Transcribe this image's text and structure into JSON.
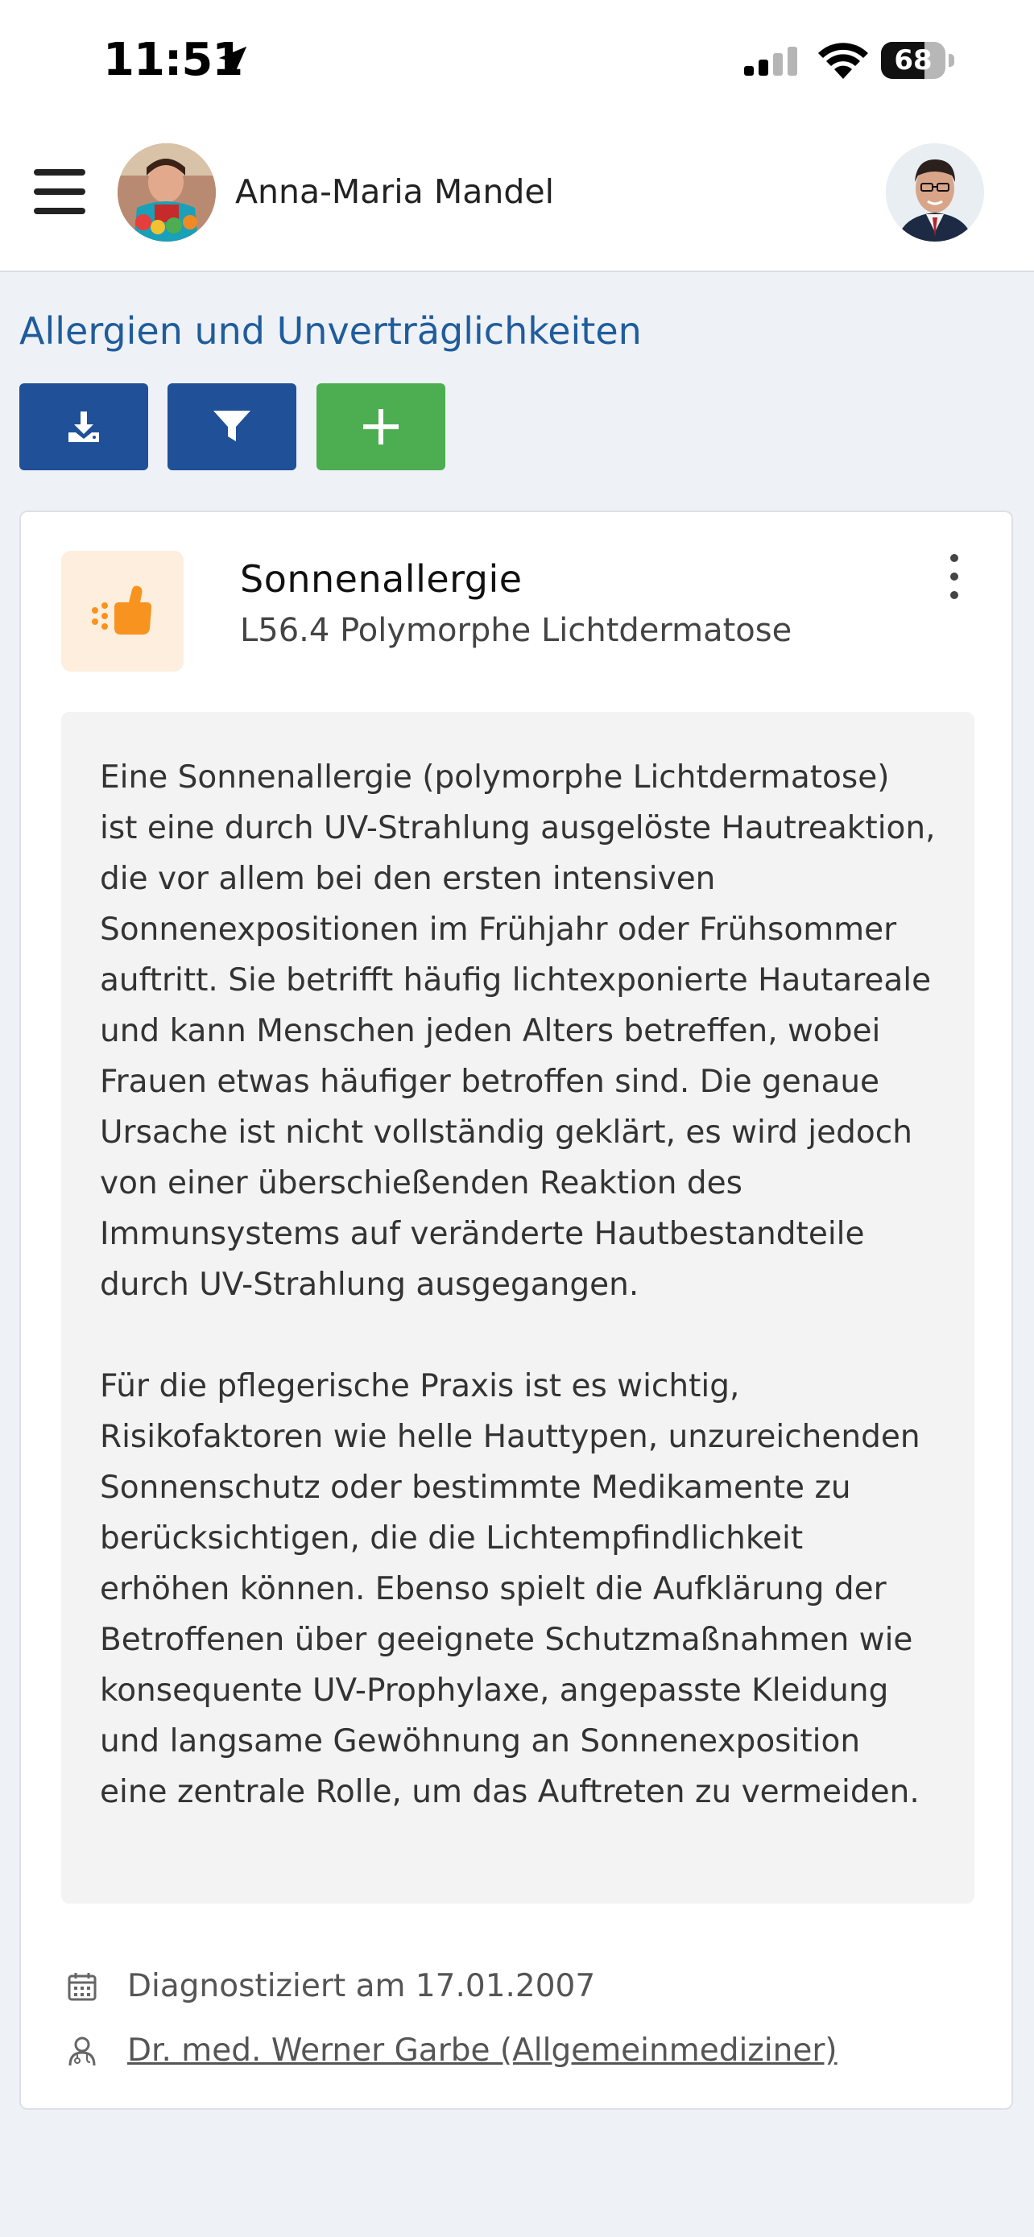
{
  "status_bar": {
    "time": "11:51",
    "battery_level": "68",
    "battery_fraction": 0.68
  },
  "header": {
    "patient_name": "Anna-Maria Mandel"
  },
  "page": {
    "title": "Allergien und Unverträglichkeiten"
  },
  "toolbar": {
    "download_icon": "download-icon",
    "filter_icon": "filter-icon",
    "add_icon": "plus-icon",
    "colors": {
      "primary": "#1f5098",
      "success": "#4cae50"
    }
  },
  "allergy": {
    "name": "Sonnenallergie",
    "code": "L56.4 Polymorphe Lichtdermatose",
    "category_icon": "hand-icon",
    "category_color": "#f7931e",
    "description_paragraphs": [
      "Eine Sonnenallergie (polymorphe Lichtdermatose) ist eine durch UV-Strahlung ausgelöste Hautreaktion, die vor allem bei den ersten intensiven Sonnenexpositionen im Frühjahr oder Frühsommer auftritt. Sie betrifft häufig lichtexponierte Hautareale und kann Menschen jeden Alters betreffen, wobei Frauen etwas häufiger betroffen sind. Die genaue Ursache ist nicht vollständig geklärt, es wird jedoch von einer überschießenden Reaktion des Immunsystems auf veränderte Hautbestandteile durch UV-Strahlung ausgegangen.",
      "Für die pflegerische Praxis ist es wichtig, Risikofaktoren wie helle Hauttypen, unzureichenden Sonnenschutz oder bestimmte Medikamente zu berücksichtigen, die die Lichtempfindlichkeit erhöhen können. Ebenso spielt die Aufklärung der Betroffenen über geeignete Schutzmaßnahmen wie konsequente UV-Prophylaxe, angepasste Kleidung und langsame Gewöhnung an Sonnenexposition eine zentrale Rolle, um das Auftreten zu vermeiden."
    ],
    "diagnosed": "Diagnostiziert am 17.01.2007",
    "doctor": "Dr. med. Werner Garbe (Allgemeinmediziner)"
  }
}
